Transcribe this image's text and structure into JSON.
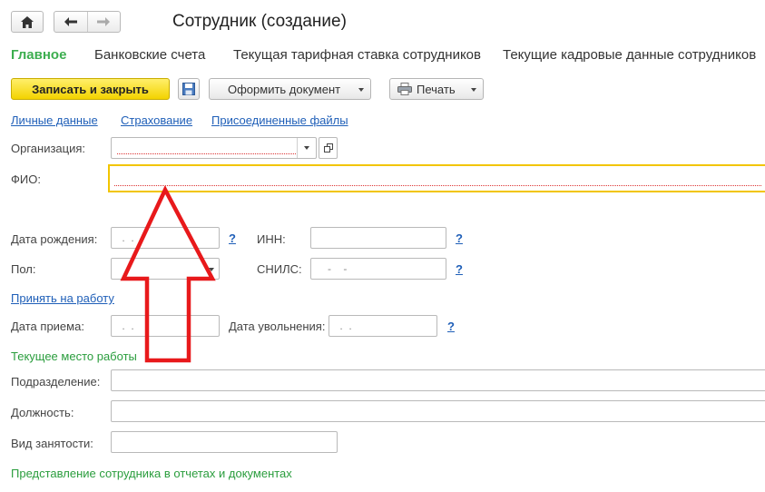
{
  "toolbar": {
    "home_icon": "home-icon",
    "back_icon": "arrow-left-icon",
    "forward_icon": "arrow-right-icon"
  },
  "window": {
    "title": "Сотрудник (создание)"
  },
  "nav": {
    "tabs": [
      {
        "label": "Главное"
      },
      {
        "label": "Банковские счета"
      },
      {
        "label": "Текущая тарифная ставка сотрудников"
      },
      {
        "label": "Текущие кадровые данные сотрудников"
      }
    ]
  },
  "commands": {
    "save_close": "Записать и закрыть",
    "save_icon": "floppy-disk-icon",
    "make_document": "Оформить документ",
    "print": "Печать"
  },
  "links": {
    "personal": "Личные данные",
    "insurance": "Страхование",
    "files": "Присоединенные файлы",
    "hire": "Принять на работу"
  },
  "fields": {
    "org_label": "Организация:",
    "org_value": "",
    "fio_label": "ФИО:",
    "fio_value": "",
    "birth_label": "Дата рождения:",
    "birth_value": " .  .",
    "inn_label": "ИНН:",
    "inn_value": "",
    "gender_label": "Пол:",
    "gender_value": "",
    "snils_label": "СНИЛС:",
    "snils_value": "   -    -",
    "hire_label": "Дата приема:",
    "hire_value": " .  .",
    "fire_label": "Дата увольнения:",
    "fire_value": " .  .",
    "dept_label": "Подразделение:",
    "dept_value": "",
    "position_label": "Должность:",
    "position_value": "",
    "employment_label": "Вид занятости:",
    "employment_value": "",
    "help": "?"
  },
  "sections": {
    "workplace": "Текущее место работы",
    "representation": "Представление сотрудника в отчетах и документах"
  },
  "annotation": {
    "arrow_color": "#e8191b"
  }
}
